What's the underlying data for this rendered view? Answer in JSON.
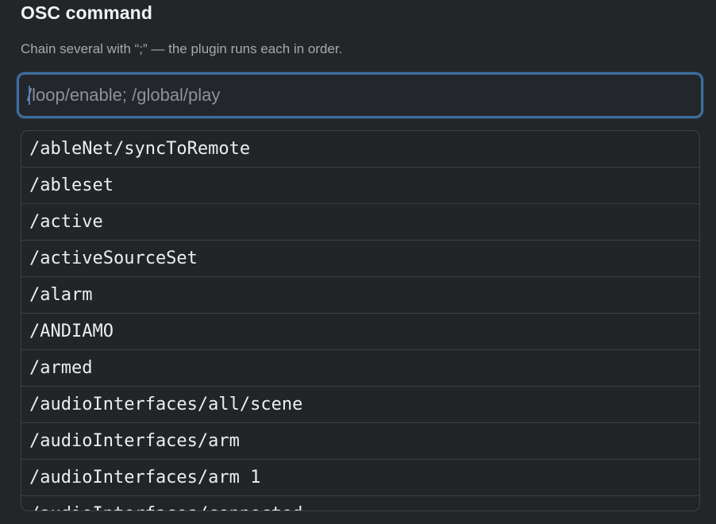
{
  "section": {
    "title": "OSC command",
    "hint": "Chain several with “;” — the plugin runs each in order."
  },
  "command_input": {
    "value": "",
    "placeholder": "/loop/enable; /global/play"
  },
  "suggestions": [
    "/ableNet/syncToRemote",
    "/ableset",
    "/active",
    "/activeSourceSet",
    "/alarm",
    "/ANDIAMO",
    "/armed",
    "/audioInterfaces/all/scene",
    "/audioInterfaces/arm",
    "/audioInterfaces/arm 1",
    "/audioInterfaces/connected"
  ],
  "colors": {
    "background": "#232629",
    "focus_ring": "#3e6ea0",
    "list_border": "#3d4144"
  }
}
